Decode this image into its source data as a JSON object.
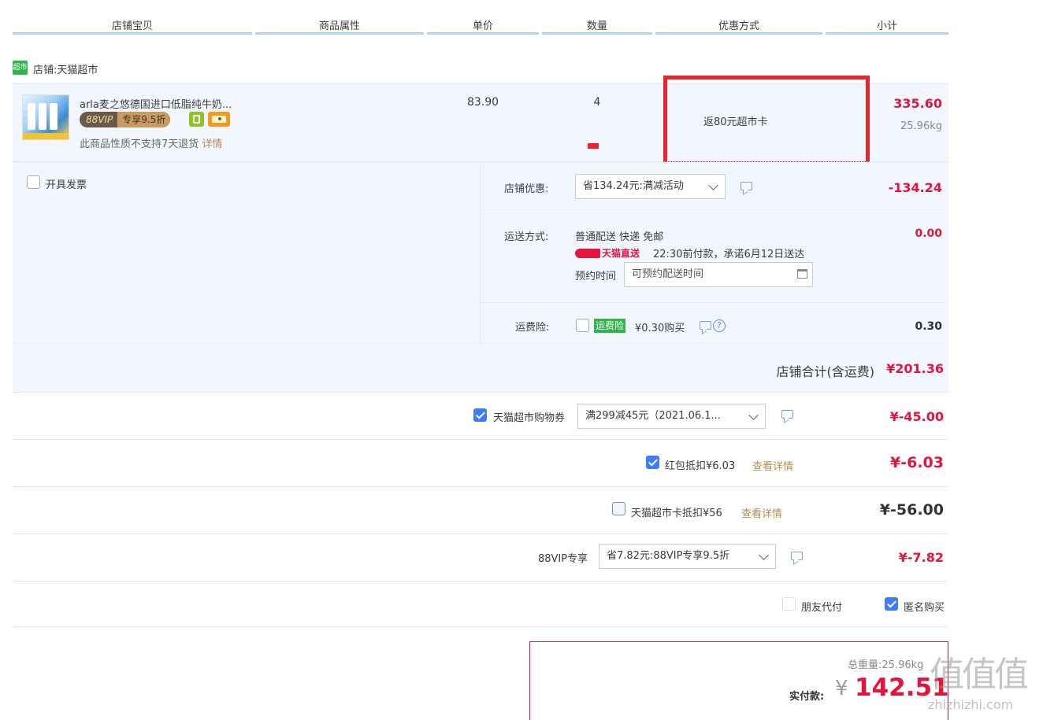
{
  "header": {
    "cols": [
      "店铺宝贝",
      "商品属性",
      "单价",
      "数量",
      "优惠方式",
      "小计"
    ]
  },
  "shop": {
    "badge": "超市",
    "label": "店铺:",
    "name": "天猫超市"
  },
  "item": {
    "title": "arla麦之悠德国进口低脂纯牛奶...",
    "vip_badge": "88VIP",
    "vip_discount": "专享9.5折",
    "return_note": "此商品性质不支持7天退货",
    "return_link": "详情",
    "unit_price": "83.90",
    "quantity": "4",
    "promo": "返80元超市卡",
    "subtotal": "335.60",
    "weight": "25.96kg"
  },
  "invoice": {
    "label": "开具发票"
  },
  "shop_discount": {
    "label": "店铺优惠:",
    "value": "省134.24元:满减活动",
    "amount": "-134.24"
  },
  "shipping": {
    "label": "运送方式:",
    "method": "普通配送 快递 免邮",
    "tmall_direct": "天猫直送",
    "promise": "22:30前付款，承诺6月12日送达",
    "schedule_label": "预约时间",
    "schedule_placeholder": "可预约配送时间",
    "amount": "0.00"
  },
  "insurance": {
    "label": "运费险:",
    "badge": "运费险",
    "price": "¥0.30购买",
    "amount": "0.30"
  },
  "shop_total": {
    "label": "店铺合计(含运费)",
    "amount": "¥201.36"
  },
  "coupon": {
    "label": "天猫超市购物券",
    "value": "满299减45元（2021.06.1...",
    "amount": "¥-45.00"
  },
  "redpacket": {
    "label": "红包抵扣¥6.03",
    "link": "查看详情",
    "amount": "¥-6.03"
  },
  "supercard": {
    "label": "天猫超市卡抵扣¥56",
    "link": "查看详情",
    "amount": "¥-56.00"
  },
  "vip": {
    "label": "88VIP专享",
    "value": "省7.82元:88VIP专享9.5折",
    "amount": "¥-7.82"
  },
  "options": {
    "friend_pay": "朋友代付",
    "anonymous": "匿名购买"
  },
  "summary": {
    "weight_label": "总重量:",
    "weight": "25.96kg",
    "pay_label": "实付款:",
    "currency": "¥",
    "amount": "142.51"
  },
  "watermark": {
    "big": "值值值",
    "small": "zhizhizhi.com"
  },
  "colors": {
    "accent_red": "#e4143c",
    "header_underline": "#b2d1ff",
    "panel_bg": "#f2f7ff",
    "highlight_box": "#e8262e",
    "checkbox_blue": "#3d7bff"
  }
}
